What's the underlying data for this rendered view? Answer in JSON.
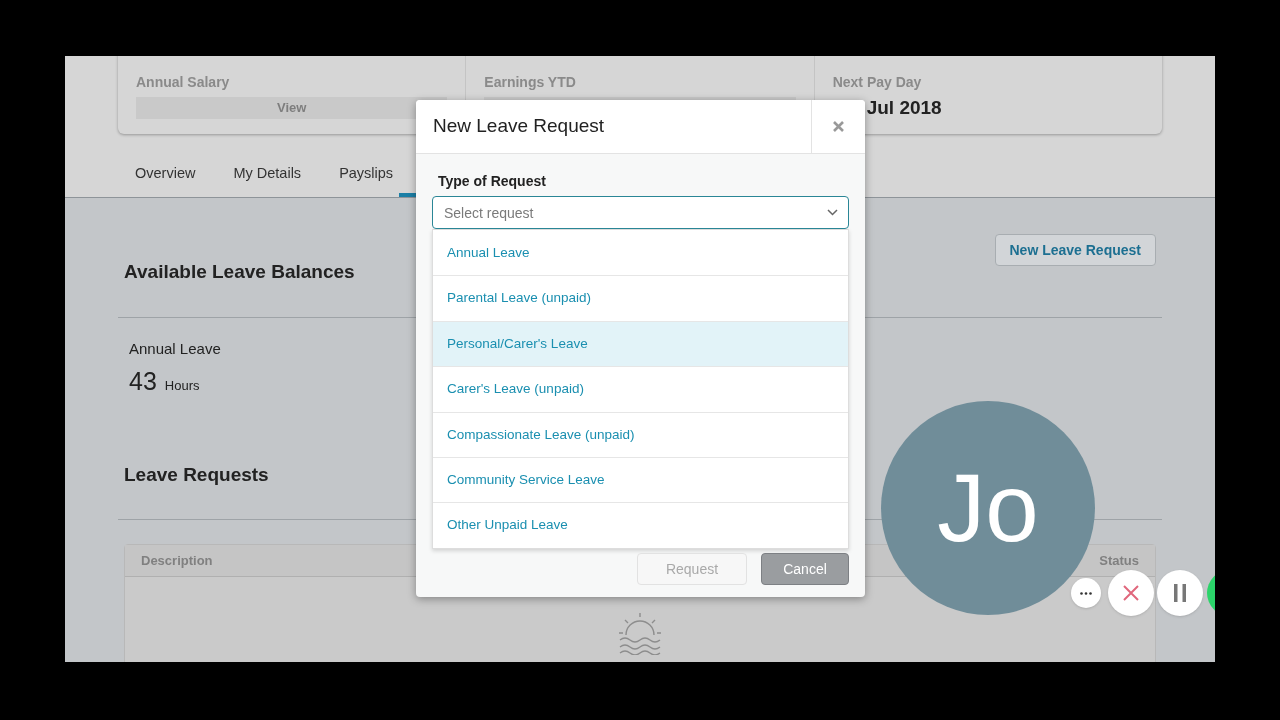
{
  "summary": [
    {
      "label": "Annual Salary",
      "kind": "button",
      "value": "View"
    },
    {
      "label": "Earnings YTD",
      "kind": "bar"
    },
    {
      "label": "Next Pay Day",
      "kind": "text",
      "value": "Jul 2018"
    }
  ],
  "tabs": [
    {
      "label": "Overview",
      "selected": false
    },
    {
      "label": "My Details",
      "selected": false
    },
    {
      "label": "Payslips",
      "selected": false
    }
  ],
  "balances": {
    "title": "Available Leave Balances",
    "button": "New Leave Request",
    "items": [
      {
        "label": "Annual Leave",
        "value": "43",
        "unit": "Hours"
      }
    ]
  },
  "requests": {
    "title": "Leave Requests",
    "columns": [
      "Description",
      "Status"
    ]
  },
  "modal": {
    "title": "New Leave Request",
    "field_label": "Type of Request",
    "placeholder": "Select request",
    "options": [
      {
        "label": "Annual Leave",
        "selected": false
      },
      {
        "label": "Parental Leave (unpaid)",
        "selected": false
      },
      {
        "label": "Personal/Carer's Leave",
        "selected": true
      },
      {
        "label": "Carer's Leave (unpaid)",
        "selected": false
      },
      {
        "label": "Compassionate Leave (unpaid)",
        "selected": false
      },
      {
        "label": "Community Service Leave",
        "selected": false
      },
      {
        "label": "Other Unpaid Leave",
        "selected": false
      }
    ],
    "buttons": [
      {
        "label": "Request",
        "disabled": true
      },
      {
        "label": "Cancel",
        "disabled": false
      }
    ]
  },
  "call": {
    "avatar": "Jo"
  }
}
